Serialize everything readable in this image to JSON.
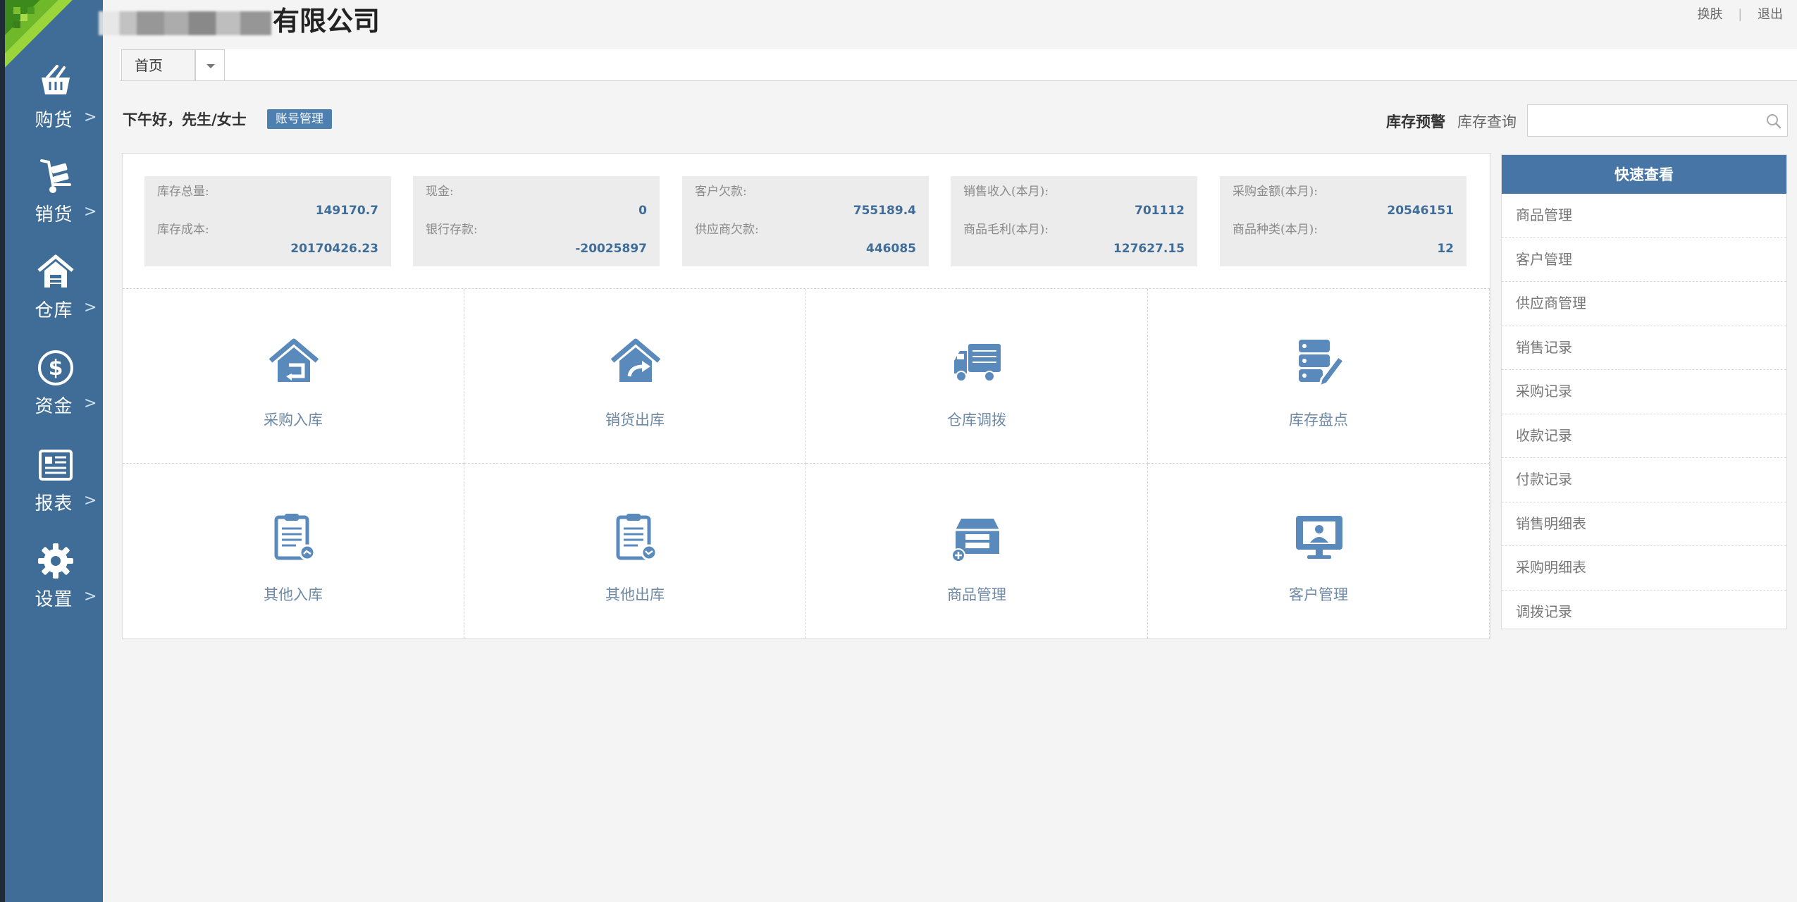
{
  "header": {
    "company_name": "有限公司",
    "links": [
      "换肤",
      "|",
      "退出"
    ]
  },
  "tabs": {
    "home_label": "首页"
  },
  "sidebar": {
    "items": [
      {
        "label": "购货",
        "icon": "basket-icon"
      },
      {
        "label": "销货",
        "icon": "hand-cart-icon"
      },
      {
        "label": "仓库",
        "icon": "warehouse-icon"
      },
      {
        "label": "资金",
        "icon": "dollar-icon"
      },
      {
        "label": "报表",
        "icon": "report-icon"
      },
      {
        "label": "设置",
        "icon": "gear-icon"
      }
    ],
    "arrow": ">"
  },
  "greeting": {
    "text": "下午好，先生/女士",
    "account_button": "账号管理"
  },
  "toolbar": {
    "stock_warning": "库存预警",
    "stock_query": "库存查询",
    "search_placeholder": ""
  },
  "stats": [
    {
      "label1": "库存总量:",
      "value1": "149170.7",
      "label2": "库存成本:",
      "value2": "20170426.23"
    },
    {
      "label1": "现金:",
      "value1": "0",
      "label2": "银行存款:",
      "value2": "-20025897"
    },
    {
      "label1": "客户欠款:",
      "value1": "755189.4",
      "label2": "供应商欠款:",
      "value2": "446085"
    },
    {
      "label1": "销售收入(本月):",
      "value1": "701112",
      "label2": "商品毛利(本月):",
      "value2": "127627.15"
    },
    {
      "label1": "采购金额(本月):",
      "value1": "20546151",
      "label2": "商品种类(本月):",
      "value2": "12"
    }
  ],
  "shortcuts": [
    {
      "label": "采购入库",
      "icon": "purchase-in-icon"
    },
    {
      "label": "销货出库",
      "icon": "sales-out-icon"
    },
    {
      "label": "仓库调拨",
      "icon": "truck-icon"
    },
    {
      "label": "库存盘点",
      "icon": "inventory-check-icon"
    },
    {
      "label": "其他入库",
      "icon": "clipboard-in-icon"
    },
    {
      "label": "其他出库",
      "icon": "clipboard-out-icon"
    },
    {
      "label": "商品管理",
      "icon": "product-box-icon"
    },
    {
      "label": "客户管理",
      "icon": "customer-monitor-icon"
    }
  ],
  "quick_view": {
    "title": "快速查看",
    "items": [
      "商品管理",
      "客户管理",
      "供应商管理",
      "销售记录",
      "采购记录",
      "收款记录",
      "付款记录",
      "销售明细表",
      "采购明细表",
      "调拨记录"
    ]
  },
  "colors": {
    "sidebar": "#3f6d97",
    "accent": "#4776a6",
    "icon": "#5a8abb"
  }
}
